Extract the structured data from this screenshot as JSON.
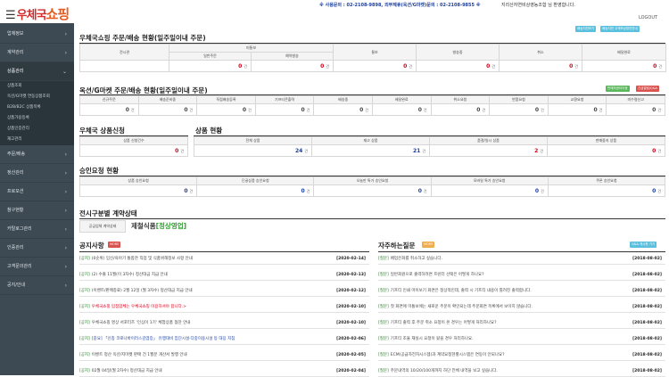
{
  "header": {
    "logo_a": "우체국",
    "logo_b": "쇼핑",
    "contact": "※ 사용문의 : 02-2108-9898, 외부제휴(옥션/G마켓)문의 : 02-2108-9855 ※",
    "user": "지리산자연비상영농조합 님 환영합니다.",
    "logout": "LOGOUT"
  },
  "sidebar": {
    "items": [
      {
        "label": "업체정보"
      },
      {
        "label": "계약관리"
      },
      {
        "label": "상품관리"
      },
      {
        "label": "주문/배송"
      },
      {
        "label": "정산관리"
      },
      {
        "label": "프로모션"
      },
      {
        "label": "참구현황"
      },
      {
        "label": "카탈로그관리"
      },
      {
        "label": "인증관리"
      },
      {
        "label": "고객문의관리"
      },
      {
        "label": "공지/안내"
      }
    ],
    "sub": [
      "상품조회",
      "옥션/G마켓 연동상품조회",
      "B2B/B2C 상품목록",
      "상품가용등록",
      "상품인증관리",
      "재고관리"
    ]
  },
  "orders": {
    "title": "우체국쇼핑 주문/배송 현황(일주일이내 주문)",
    "btn1": "배송지연보기",
    "btn2": "배송지연 고객보상방안안내",
    "c1": "전시관",
    "c2": "미통보",
    "c2a": "일반주문",
    "c2b": "예약발송",
    "c3": "통보",
    "c4": "발송중",
    "c5": "취소",
    "c6": "배달완료",
    "v1": "0",
    "v2": "0",
    "v3": "0",
    "v4": "0",
    "v5": "0",
    "v6": "0",
    "unit": "건"
  },
  "auction": {
    "title": "옥션/G마켓 주문/배송 현황(일주일이내 주문)",
    "btn1": "판매자센터이동",
    "btn2": "긴급알림/Q&A",
    "cols": [
      "신규주문",
      "배송준비중",
      "직접배송등록",
      "기프티콘출력",
      "배송중",
      "배달완료",
      "취소요청",
      "반품요청",
      "교환요청",
      "미수령신고"
    ],
    "vals": [
      "0",
      "0",
      "0",
      "0",
      "0",
      "0",
      "0",
      "0",
      "0",
      "0"
    ]
  },
  "apply": {
    "title": "우체국 상품신청",
    "col": "상품 신청건수",
    "val": "0"
  },
  "goods": {
    "title": "상품 현황",
    "cols": [
      "전체 상품",
      "재고 상품",
      "품절/일시 상품",
      "판매중지 상품"
    ],
    "vals": [
      "24",
      "21",
      "2",
      "0"
    ]
  },
  "approve": {
    "title": "승인요청 현황",
    "cols": [
      "상품 승인요청",
      "단골상품 승인요청",
      "오늘만 특가 승인요청",
      "모바일 특가 승인요청",
      "쿠폰 승인요청"
    ],
    "vals": [
      "0",
      "0",
      "0",
      "0",
      "0"
    ]
  },
  "contract": {
    "title": "전시구분별 계약상태",
    "label": "공급업체 계약상태",
    "value_a": "제철식품",
    "value_b": "[정상영업]"
  },
  "notice": {
    "title": "공지사항",
    "more": "MORE",
    "rows": [
      {
        "cat": "[공지]",
        "text": "(0순위) 임신/육아기 통합관 직업 및 식품위해정보 사항 안내",
        "date": "[2020-02-14]"
      },
      {
        "cat": "[공지]",
        "text": "(2) 수출 11월(이 3차수) 정산대금 지급 안내",
        "date": "[2020-02-13]"
      },
      {
        "cat": "[공지]",
        "text": "(이벤트/판매종료) 2월 12일 (월 3차수) 정산대금 지급 안내",
        "date": "[2020-02-12]"
      },
      {
        "cat": "[공지]",
        "text": "우체국쇼핑 입점업체는 우체국쇼핑 이용하셔야 합니다.>",
        "date": "[2020-02-10]"
      },
      {
        "cat": "[공지]",
        "text": "우체국쇼핑 명상 서포터즈 '인심이 1기' 체험상품 협찬 안내",
        "date": "[2020-02-10]"
      },
      {
        "cat": "[공지]",
        "text": "[중요] 「신종 코로나바이러스감염증」 유행대비 집단시설·다중이용시설 등 대응 지침",
        "date": "[2020-02-06]"
      },
      {
        "cat": "[공지]",
        "text": "이벤트 정산 옥션/지마켓 판매 건 1월분 개산서 발행 안내",
        "date": "[2020-02-05]"
      },
      {
        "cat": "[공지]",
        "text": "02월 04일(월 2차수) 정산대금 지급 안내",
        "date": "[2020-02-04]"
      }
    ]
  },
  "faq": {
    "title": "자주하는질문",
    "more": "MORE",
    "btn": "Q&A 게시판 가기",
    "rows": [
      {
        "cat": "[질문]",
        "text": "배업은화를 취소하고 싶습니다.",
        "date": "[2018-08-02]"
      },
      {
        "cat": "[질문]",
        "text": "일반회원으로 출력하려면 프린터 선택은 어떻게 하나요?",
        "date": "[2018-08-02]"
      },
      {
        "cat": "[질문]",
        "text": "기프티 인쇄 마이보기 화면은 정상적인데, 출력 시 기프티 내용이 틀려진 출력합니다.",
        "date": "[2018-08-02]"
      },
      {
        "cat": "[질문]",
        "text": "첫 화면에 미통보에는 새로운 주문이 확인되는데 주문화면 목록에서 보이지 않습니다.",
        "date": "[2018-08-02]"
      },
      {
        "cat": "[질문]",
        "text": "기프티 출력 후 주문 취소 요청이 온 경우는 어떻게 처리하나요?",
        "date": "[2018-08-02]"
      },
      {
        "cat": "[질문]",
        "text": "기프티 조율 재실시 요청이 왔을 경우 처리하나요.",
        "date": "[2018-08-02]"
      },
      {
        "cat": "[질문]",
        "text": "ECM(공급자전자시스템)과 계약요청현황시스템은 연동이 안되나요?",
        "date": "[2018-08-02]"
      },
      {
        "cat": "[질문]",
        "text": "주문내역의 10/20/100개까지 하단 전체 내역을 보고 싶습니다.",
        "date": "[2018-08-02]"
      }
    ]
  }
}
